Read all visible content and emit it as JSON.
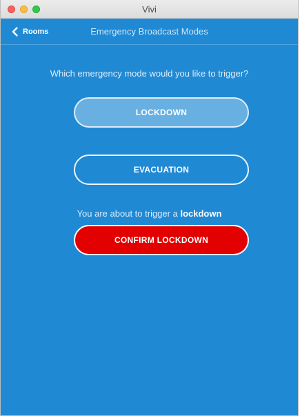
{
  "window": {
    "title": "Vivi",
    "background": "#2089d4"
  },
  "navigation": {
    "back_label": "Rooms",
    "back_icon": "chevron-left-icon",
    "title": "Emergency Broadcast Modes"
  },
  "content": {
    "question": "Which emergency mode would you like to trigger?",
    "modes": [
      {
        "label": "LOCKDOWN",
        "selected": true
      },
      {
        "label": "EVACUATION",
        "selected": false
      }
    ],
    "trigger_prefix": "You are about to trigger a",
    "trigger_mode": "lockdown",
    "confirm_label": "CONFIRM LOCKDOWN"
  },
  "colors": {
    "accent_blue": "#2089d4",
    "confirm_red": "#e20000",
    "text_white": "#ffffff"
  }
}
